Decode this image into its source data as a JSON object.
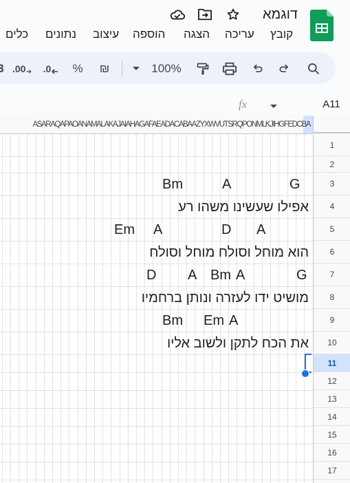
{
  "header": {
    "title": "דוגמא",
    "icons": [
      "star-icon",
      "move-to-folder-icon",
      "cloud-saved-icon"
    ]
  },
  "menu": [
    {
      "label": "קובץ"
    },
    {
      "label": "עריכה"
    },
    {
      "label": "הצגה"
    },
    {
      "label": "הוספה"
    },
    {
      "label": "עיצוב"
    },
    {
      "label": "נתונים"
    },
    {
      "label": "כלים"
    }
  ],
  "toolbar": {
    "zoom": "100%",
    "currency": "₪",
    "percent": "%",
    "decrease_decimals": ".0",
    "increase_decimals": ".00",
    "more_formats": "3"
  },
  "formula_bar": {
    "cell_ref": "A11",
    "fx": "fx"
  },
  "columns_strip": "ASARAQAPAOANAMALAKAJAIAHAGAFAEADACABAAZYXWVUTSRQPONMLKJIHGFEDCBA",
  "rows": [
    "1",
    "2",
    "3",
    "4",
    "5",
    "6",
    "7",
    "8",
    "9",
    "10",
    "11",
    "12",
    "13",
    "14",
    "15",
    "16",
    "17"
  ],
  "selected_row": "11",
  "cells": {
    "r3": [
      "G",
      "A",
      "Bm"
    ],
    "r4": "אפילו שעשינו משהו רע",
    "r5": [
      "A",
      "D",
      "A",
      "Em"
    ],
    "r6": "הוא מוחל וסולח מוחל וסולח",
    "r7": [
      "G",
      "A",
      "Bm",
      "A",
      "D"
    ],
    "r8": "מושיט ידו לעזרה ונותן ברחמיו",
    "r9": [
      "A",
      "Em",
      "Bm"
    ],
    "r10": "את הכח לתקן ולשוב אליו"
  },
  "colors": {
    "accent": "#1a73e8",
    "toolbar_bg": "#edf2fa",
    "selected_header": "#d3e3fd",
    "logo_green": "#0f9d58"
  }
}
